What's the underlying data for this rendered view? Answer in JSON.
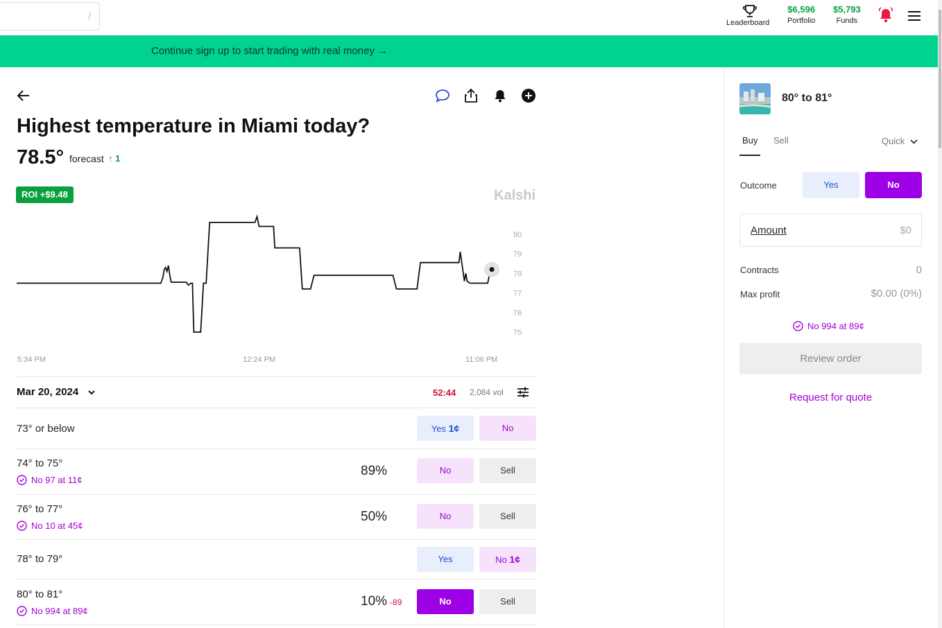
{
  "header": {
    "search_shortcut": "/",
    "leaderboard_label": "Leaderboard",
    "portfolio_value": "$6,596",
    "portfolio_label": "Portfolio",
    "funds_value": "$5,793",
    "funds_label": "Funds",
    "icons": [
      "trophy-icon",
      "bell-alert-icon",
      "menu-icon"
    ]
  },
  "banner": {
    "text": "Continue sign up to start trading with real money →"
  },
  "market": {
    "title": "Highest temperature in Miami today?",
    "forecast_value": "78.5°",
    "forecast_label": "forecast",
    "forecast_change": "↑ 1",
    "roi_badge": "ROI +$9.48",
    "watermark": "Kalshi",
    "toolbar_icons": [
      "back-arrow-icon",
      "comment-icon",
      "share-icon",
      "bell-icon",
      "add-circle-icon"
    ]
  },
  "chart_data": {
    "type": "line",
    "title": "",
    "xlabel": "",
    "ylabel": "",
    "x_tick_labels": [
      "5:34 PM",
      "12:24 PM",
      "11:06 PM"
    ],
    "y_tick_labels": [
      "80",
      "79",
      "78",
      "77",
      "76",
      "75"
    ],
    "ylim": [
      74.4,
      81.2
    ],
    "y_axis_position": "right",
    "grid": false,
    "series": [
      {
        "color": "#111111",
        "points": [
          [
            0,
            77.5
          ],
          [
            210,
            77.5
          ],
          [
            213,
            77.8
          ],
          [
            215,
            78.2
          ],
          [
            217,
            78.3
          ],
          [
            219,
            78.1
          ],
          [
            221,
            78.4
          ],
          [
            223,
            77.9
          ],
          [
            225,
            77.55
          ],
          [
            237,
            77.55
          ],
          [
            247,
            77.55
          ],
          [
            250,
            77.4
          ],
          [
            254,
            77.5
          ],
          [
            256,
            77.5
          ],
          [
            258,
            75.0
          ],
          [
            268,
            75.0
          ],
          [
            272,
            77.5
          ],
          [
            276,
            77.5
          ],
          [
            281,
            80.6
          ],
          [
            347,
            80.6
          ],
          [
            350,
            80.9
          ],
          [
            353,
            80.4
          ],
          [
            374,
            80.4
          ],
          [
            376,
            79.3
          ],
          [
            412,
            79.3
          ],
          [
            416,
            77.2
          ],
          [
            428,
            77.2
          ],
          [
            433,
            77.9
          ],
          [
            548,
            77.9
          ],
          [
            553,
            77.2
          ],
          [
            583,
            77.2
          ],
          [
            588,
            78.55
          ],
          [
            644,
            78.55
          ],
          [
            646,
            79.1
          ],
          [
            648,
            78.6
          ],
          [
            652,
            77.6
          ],
          [
            654,
            78.0
          ],
          [
            656,
            77.6
          ],
          [
            660,
            77.5
          ],
          [
            686,
            77.5
          ],
          [
            690,
            78.2
          ],
          [
            692,
            78.2
          ]
        ]
      }
    ],
    "last_point_marker": true
  },
  "date_bar": {
    "date": "Mar 20, 2024",
    "timer": "52:44",
    "volume": "2,084 vol"
  },
  "rows": [
    {
      "range": "73° or below",
      "position": "",
      "pct": "",
      "change": "",
      "yes_label": "Yes",
      "yes_price": "1¢",
      "no_label": "No"
    },
    {
      "range": "74° to 75°",
      "position": "No 97 at 11¢",
      "pct": "89%",
      "change": "",
      "no_label": "No",
      "sell_label": "Sell"
    },
    {
      "range": "76° to 77°",
      "position": "No 10 at 45¢",
      "pct": "50%",
      "change": "",
      "no_label": "No",
      "sell_label": "Sell"
    },
    {
      "range": "78° to 79°",
      "position": "",
      "pct": "",
      "change": "",
      "yes_label": "Yes",
      "no_label": "No",
      "no_price": "1¢"
    },
    {
      "range": "80° to 81°",
      "position": "No 994 at 89¢",
      "pct": "10%",
      "change": "-89",
      "no_label": "No",
      "sell_label": "Sell"
    }
  ],
  "order_panel": {
    "title": "80° to 81°",
    "tab_buy": "Buy",
    "tab_sell": "Sell",
    "mode": "Quick",
    "outcome_label": "Outcome",
    "yes_label": "Yes",
    "no_label": "No",
    "amount_label": "Amount",
    "amount_value": "$0",
    "contracts_label": "Contracts",
    "contracts_value": "0",
    "max_profit_label": "Max profit",
    "max_profit_value": "$0.00 (0%)",
    "position_note": "No 994 at 89¢",
    "review_label": "Review order",
    "rfq_label": "Request for quote"
  },
  "colors": {
    "brand_green": "#00d390",
    "gain_green": "#0a9f3f",
    "purple": "#9d00e6",
    "blue": "#1f4fd6",
    "alert_red": "#d0103a"
  }
}
